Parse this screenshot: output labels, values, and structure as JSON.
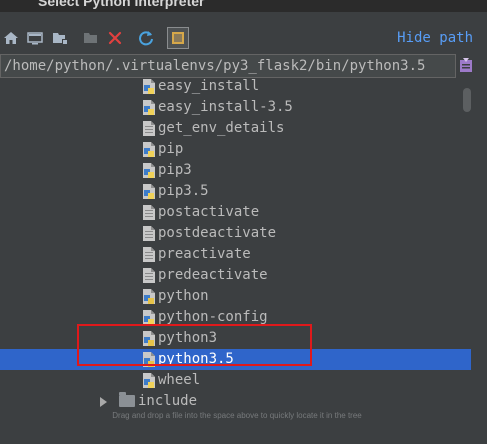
{
  "dialog": {
    "title": "Select Python Interpreter"
  },
  "toolbar": {
    "buttons": [
      {
        "icon": "home-icon"
      },
      {
        "icon": "desktop-icon"
      },
      {
        "icon": "project-folder-icon"
      },
      {
        "icon": "new-folder-icon"
      },
      {
        "icon": "delete-icon"
      },
      {
        "icon": "refresh-icon"
      },
      {
        "icon": "show-hidden-icon"
      }
    ],
    "hide_path_label": "Hide path"
  },
  "path": {
    "value": "/home/python/.virtualenvs/py3_flask2/bin/python3.5"
  },
  "tree": {
    "items": [
      {
        "label": "easy_install",
        "icon": "python-script-icon",
        "selected": false
      },
      {
        "label": "easy_install-3.5",
        "icon": "python-script-icon",
        "selected": false
      },
      {
        "label": "get_env_details",
        "icon": "file-icon",
        "selected": false
      },
      {
        "label": "pip",
        "icon": "python-script-icon",
        "selected": false
      },
      {
        "label": "pip3",
        "icon": "python-script-icon",
        "selected": false
      },
      {
        "label": "pip3.5",
        "icon": "python-script-icon",
        "selected": false
      },
      {
        "label": "postactivate",
        "icon": "file-icon",
        "selected": false
      },
      {
        "label": "postdeactivate",
        "icon": "file-icon",
        "selected": false
      },
      {
        "label": "preactivate",
        "icon": "file-icon",
        "selected": false
      },
      {
        "label": "predeactivate",
        "icon": "file-icon",
        "selected": false
      },
      {
        "label": "python",
        "icon": "python-executable-icon",
        "selected": false
      },
      {
        "label": "python-config",
        "icon": "python-script-icon",
        "selected": false
      },
      {
        "label": "python3",
        "icon": "python-executable-icon",
        "selected": false
      },
      {
        "label": "python3.5",
        "icon": "python-executable-icon",
        "selected": true
      },
      {
        "label": "wheel",
        "icon": "python-script-icon",
        "selected": false
      }
    ],
    "folder": {
      "label": "include",
      "icon": "folder-icon",
      "expanded": false
    }
  },
  "hint": "Drag and drop a file into the space above to quickly locate it in the tree",
  "colors": {
    "background": "#3c3f41",
    "selection": "#2f65ca",
    "link": "#589df6",
    "annotation_box": "#e0191b"
  }
}
